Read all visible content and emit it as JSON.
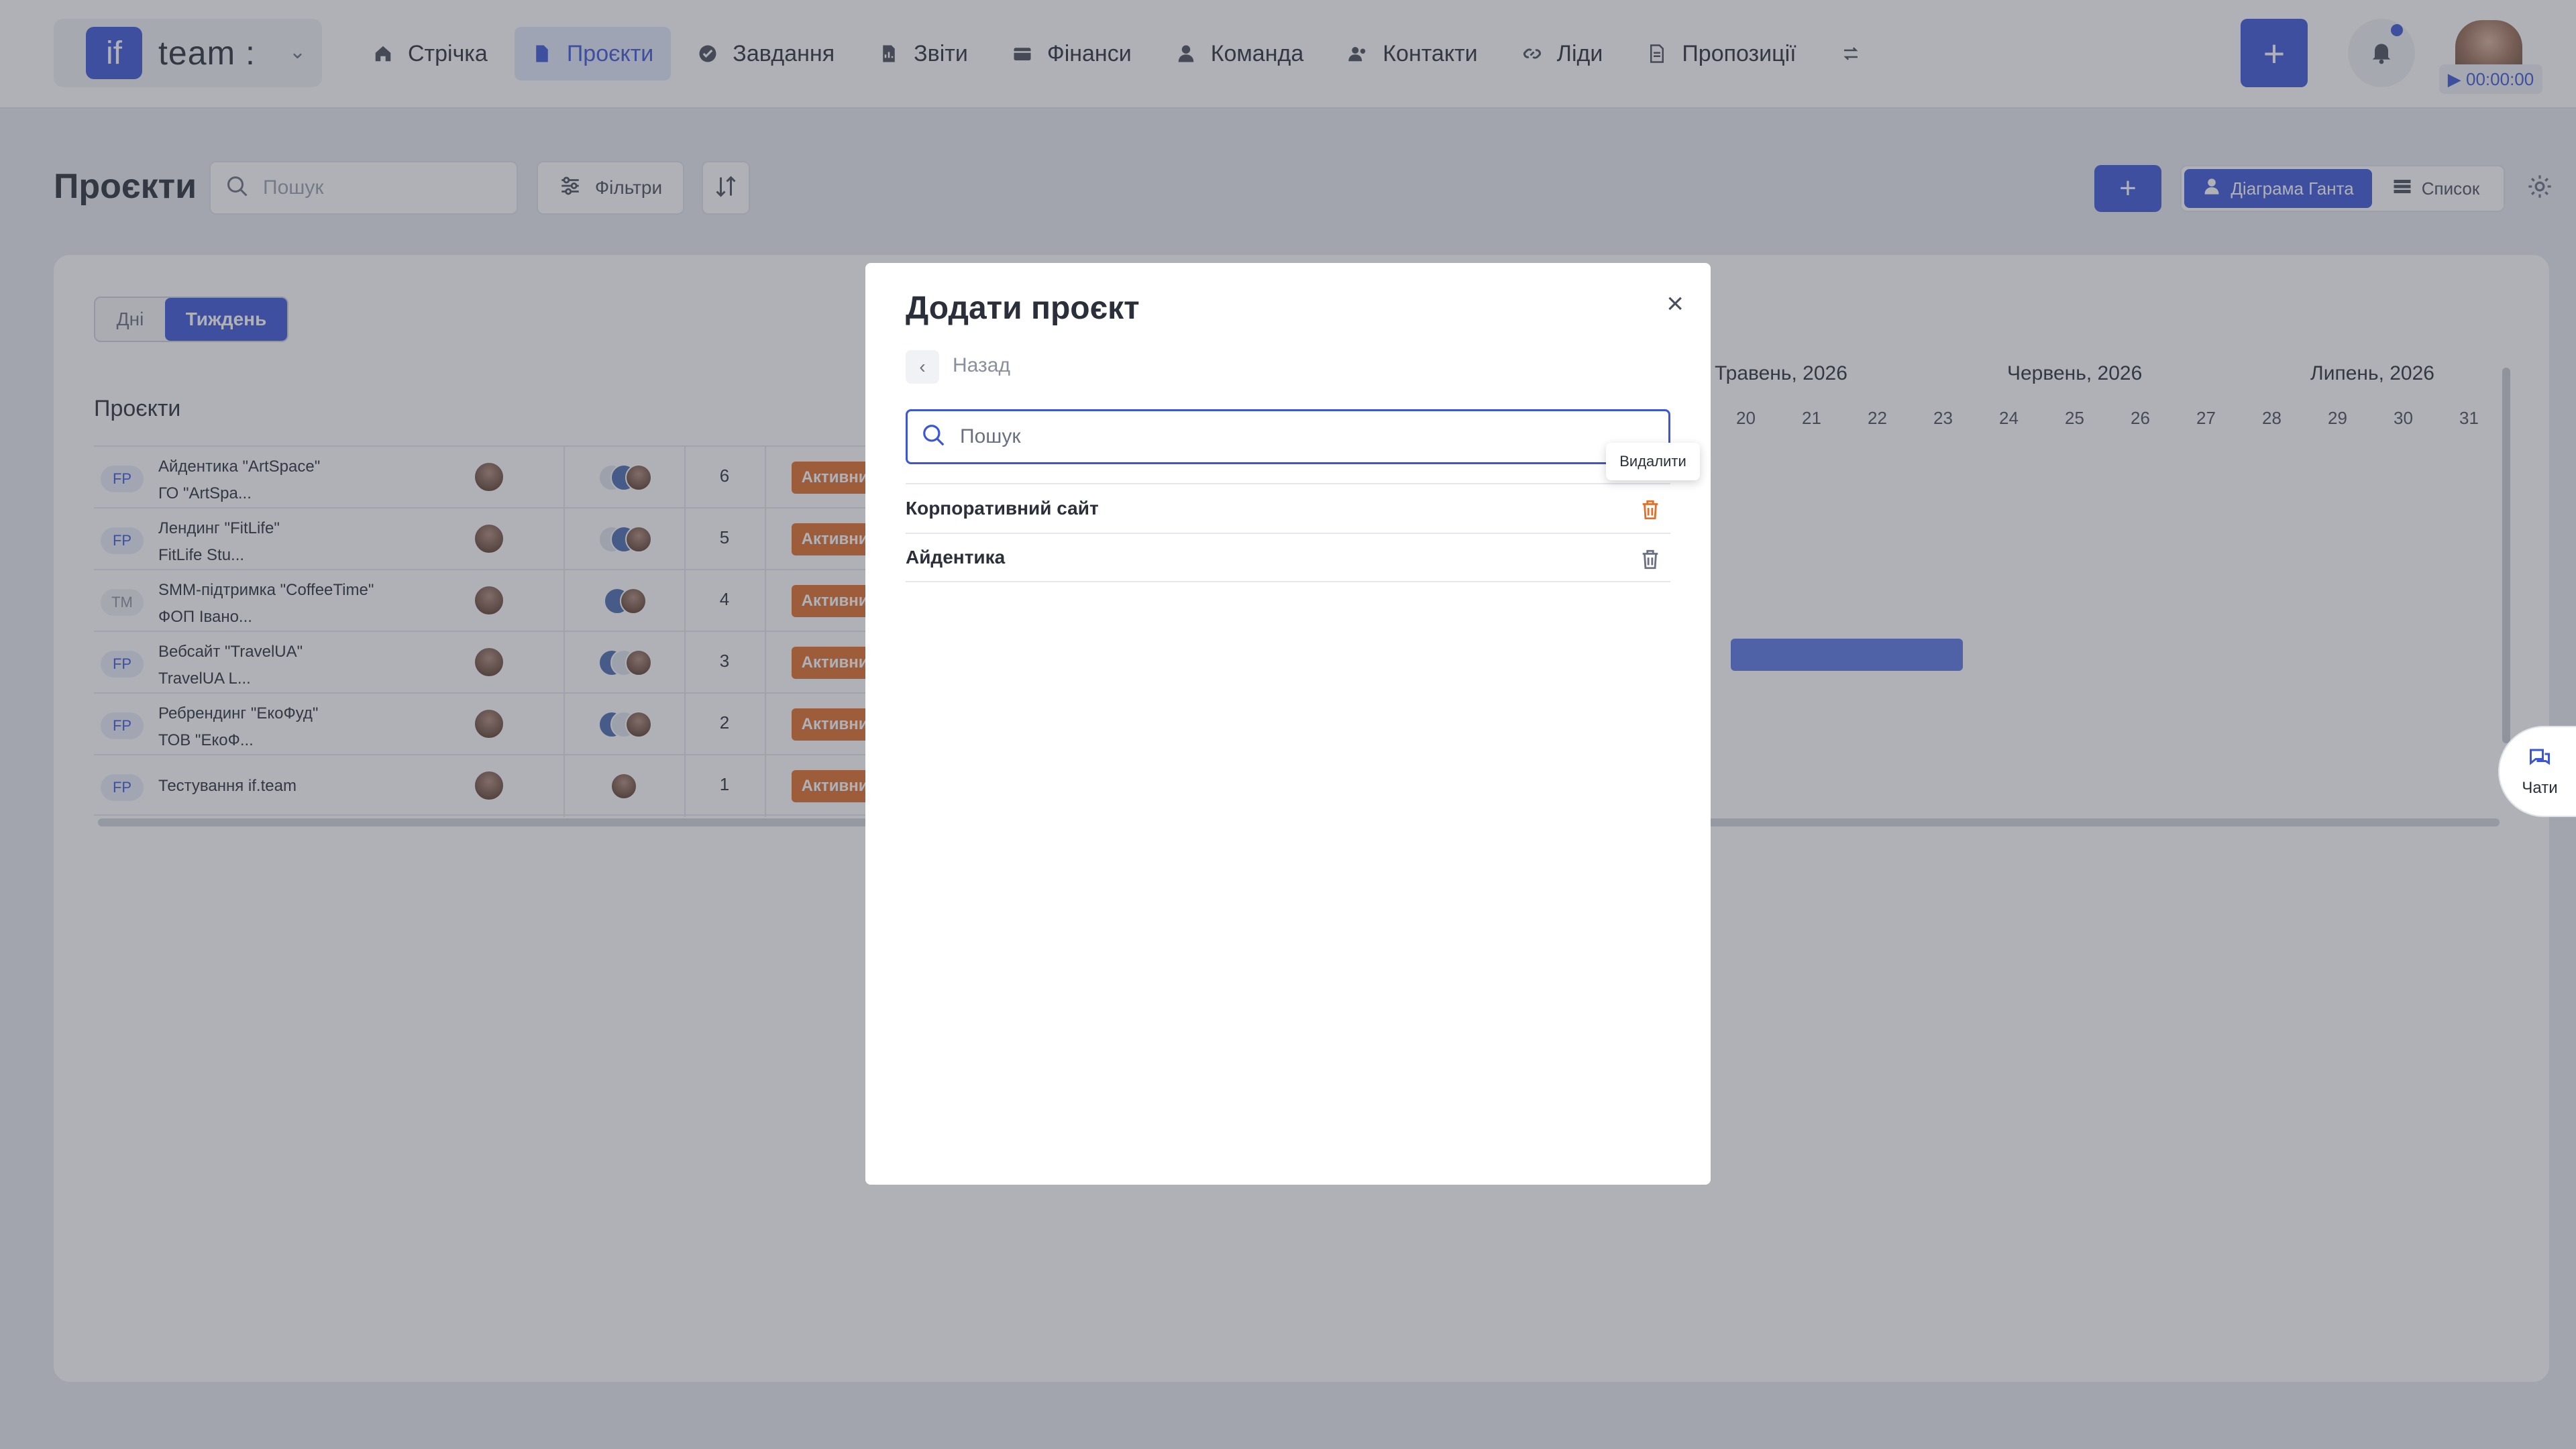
{
  "brand": {
    "logo_text": "if",
    "name": "team :"
  },
  "nav": {
    "items": [
      {
        "label": "Стрічка",
        "icon": "home-icon",
        "active": false
      },
      {
        "label": "Проєкти",
        "icon": "document-icon",
        "active": true
      },
      {
        "label": "Завдання",
        "icon": "check-circle-icon",
        "active": false
      },
      {
        "label": "Звіти",
        "icon": "report-icon",
        "active": false
      },
      {
        "label": "Фінанси",
        "icon": "wallet-icon",
        "active": false
      },
      {
        "label": "Команда",
        "icon": "user-icon",
        "active": false
      },
      {
        "label": "Контакти",
        "icon": "contacts-icon",
        "active": false
      },
      {
        "label": "Ліди",
        "icon": "link-icon",
        "active": false
      },
      {
        "label": "Пропозиції",
        "icon": "file-icon",
        "active": false
      }
    ],
    "more_icon": "swap-icon",
    "add_label": "+",
    "timer": "▶ 00:00:00"
  },
  "page": {
    "title": "Проєкти",
    "search_placeholder": "Пошук",
    "filters_label": "Фільтри",
    "add_label": "+",
    "view_gantt_label": "Діаграма Ганта",
    "view_list_label": "Список"
  },
  "period": {
    "days_label": "Дні",
    "week_label": "Тиждень"
  },
  "projects": {
    "heading": "Проєкти",
    "rows": [
      {
        "badge": "FP",
        "name": "Айдентика \"ArtSpace\"",
        "client": "ГО \"ArtSpa...",
        "count": "6",
        "status": "Активний"
      },
      {
        "badge": "FP",
        "name": "Лендинг \"FitLife\"",
        "client": "FitLife Stu...",
        "count": "5",
        "status": "Активний"
      },
      {
        "badge": "TM",
        "name": "SMM-підтримка \"CoffeeTime\"",
        "client": "ФОП Івано...",
        "count": "4",
        "status": "Активний"
      },
      {
        "badge": "FP",
        "name": "Вебсайт \"TravelUA\"",
        "client": "TravelUA L...",
        "count": "3",
        "status": "Активний"
      },
      {
        "badge": "FP",
        "name": "Ребрендинг \"ЕкоФуд\"",
        "client": "ТОВ \"ЕкоФ...",
        "count": "2",
        "status": "Активний"
      },
      {
        "badge": "FP",
        "name": "Тестування if.team",
        "client": "",
        "count": "1",
        "status": "Активний"
      }
    ]
  },
  "gantt": {
    "months": [
      "Травень, 2026",
      "Червень, 2026",
      "Липень, 2026"
    ],
    "days": [
      "20",
      "21",
      "22",
      "23",
      "24",
      "25",
      "26",
      "27",
      "28",
      "29",
      "30",
      "31"
    ]
  },
  "chats_label": "Чати",
  "modal": {
    "title": "Додати проєкт",
    "close_label": "×",
    "back_label": "Назад",
    "search_placeholder": "Пошук",
    "items": [
      {
        "name": "Корпоративний сайт"
      },
      {
        "name": "Айдентика"
      }
    ],
    "delete_tooltip": "Видалити"
  },
  "colors": {
    "accent": "#3b56d6",
    "status_active": "#e16f2a",
    "delete_hover": "#e16f2a"
  }
}
